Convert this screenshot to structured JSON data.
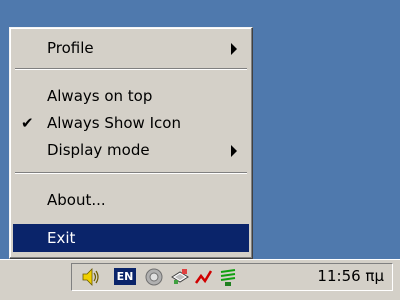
{
  "menu": {
    "items": [
      {
        "label": "Profile",
        "submenu": true
      },
      {
        "label": "Always on top"
      },
      {
        "label": "Always Show Icon",
        "checked": true
      },
      {
        "label": "Display mode",
        "submenu": true
      },
      {
        "label": "About..."
      },
      {
        "label": "Exit",
        "highlighted": true
      }
    ],
    "check_glyph": "✔"
  },
  "tray": {
    "language": "EN",
    "clock": "11:56 πμ",
    "icons": [
      "speaker-icon",
      "language-indicator",
      "network-monitor-icon",
      "printer-icon",
      "red-zigzag-icon",
      "green-network-icon"
    ]
  },
  "colors": {
    "desktop": "#4f79ad",
    "menu_bg": "#d4d0c8",
    "highlight": "#0a246a"
  }
}
